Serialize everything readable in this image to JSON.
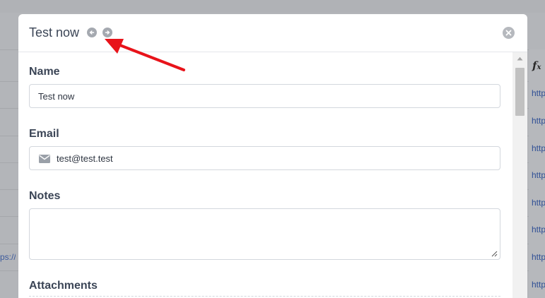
{
  "background": {
    "left_partial_link": "ps://",
    "right_column_header_icon": "fx-icon",
    "right_partial_links": [
      "http",
      "http",
      "http",
      "http",
      "http",
      "http",
      "http",
      "http"
    ]
  },
  "modal": {
    "title": "Test now",
    "prev_icon": "arrow-left-circle-icon",
    "next_icon": "arrow-right-circle-icon",
    "close_icon": "close-circle-icon",
    "fields": {
      "name": {
        "label": "Name",
        "value": "Test now"
      },
      "email": {
        "label": "Email",
        "value": "test@test.test",
        "icon": "envelope-icon"
      },
      "notes": {
        "label": "Notes",
        "value": ""
      },
      "attachments": {
        "label": "Attachments"
      }
    }
  },
  "annotation": {
    "color": "#e8131a",
    "icon": "red-arrow-pointer"
  },
  "colors": {
    "link": "#2f4f95",
    "label": "#3b4556",
    "border": "#d3d7dd"
  }
}
